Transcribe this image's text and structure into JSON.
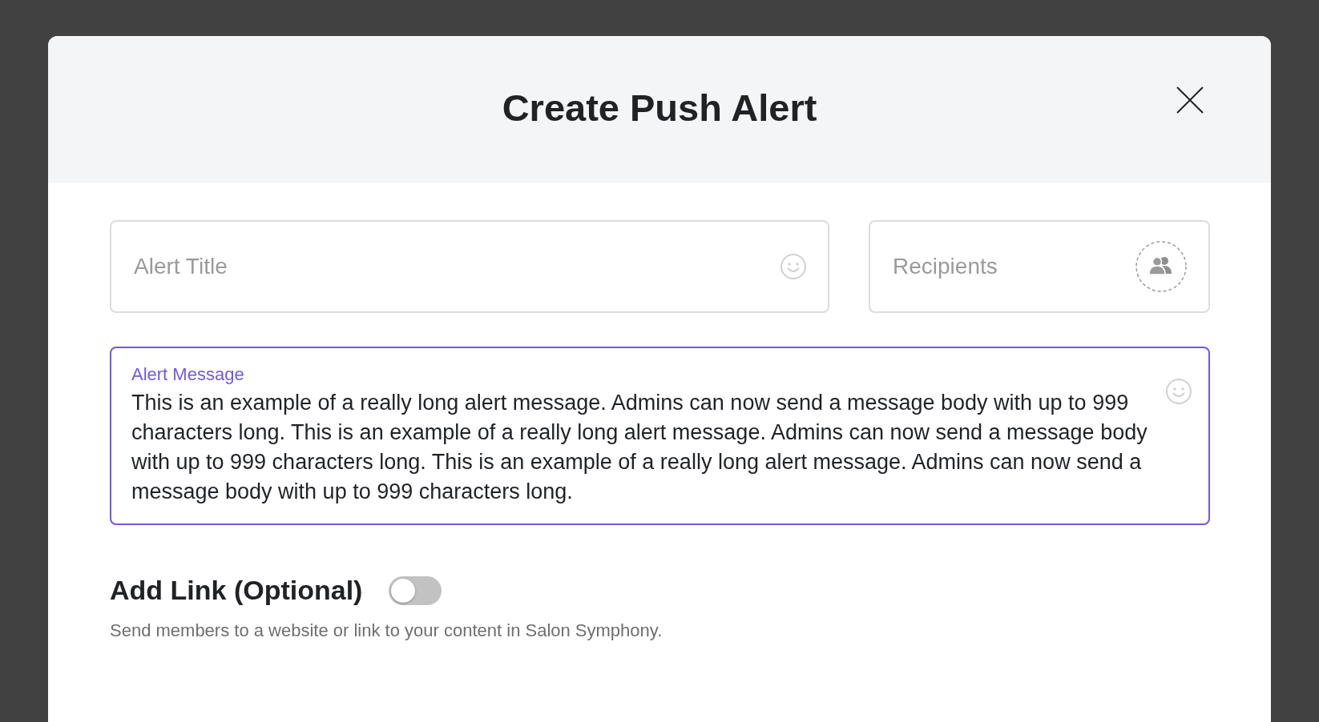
{
  "dialog": {
    "title": "Create Push Alert"
  },
  "fields": [
    {
      "kind": "text",
      "placeholder": "Alert Title",
      "focused": false
    },
    {
      "kind": "recipients",
      "placeholder": "Recipients",
      "focused": false
    }
  ],
  "message": {
    "label": "Alert Message",
    "value": "This is an example of a really long alert message. Admins can now send a message body with up to 999 characters long. This is an example of a really long alert message. Admins can now send a message body with up to 999 characters long. This is an example of a really long alert message. Admins can now send a message body with up to 999 characters long.",
    "focused": true
  },
  "link_option": {
    "label": "Add Link (Optional)",
    "on": false,
    "description": "Send members to a website or link to your content in Salon Symphony."
  }
}
